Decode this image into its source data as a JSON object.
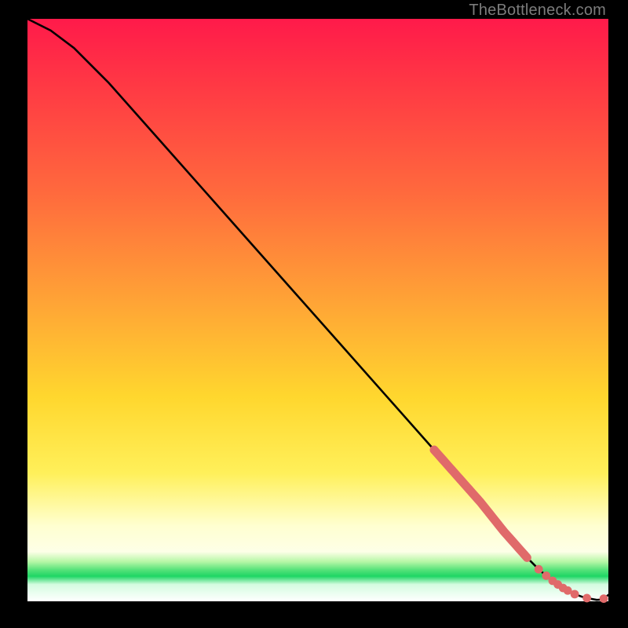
{
  "meta": {
    "credit": "TheBottleneck.com"
  },
  "colors": {
    "curve": "#000000",
    "dots": "#e06a6a",
    "thick": "#e06a6a"
  },
  "chart_data": {
    "type": "line",
    "title": "",
    "xlabel": "",
    "ylabel": "",
    "xlim": [
      0,
      100
    ],
    "ylim": [
      0,
      100
    ],
    "grid": false,
    "legend": false,
    "annotations": [],
    "series": [
      {
        "name": "curve",
        "x": [
          0,
          4,
          8,
          14,
          22,
          30,
          38,
          46,
          54,
          62,
          70,
          74,
          78,
          82,
          86,
          88,
          90,
          92,
          94,
          96,
          98,
          99,
          100
        ],
        "y": [
          100,
          98,
          95,
          89,
          80,
          71,
          62,
          53,
          44,
          35,
          26,
          21.5,
          17,
          12,
          7.5,
          5.5,
          3.8,
          2.4,
          1.3,
          0.6,
          0.25,
          0.3,
          1.1
        ]
      }
    ],
    "highlight_thick_segments_x": [
      [
        70,
        86
      ]
    ],
    "dots_x": [
      70,
      71.5,
      73,
      74.5,
      76,
      77.5,
      79.5,
      81,
      83,
      85.5,
      88,
      89.3,
      90.4,
      91.3,
      92.2,
      93,
      94.2,
      96.3,
      99.2
    ],
    "dot_radius": 5.4
  }
}
